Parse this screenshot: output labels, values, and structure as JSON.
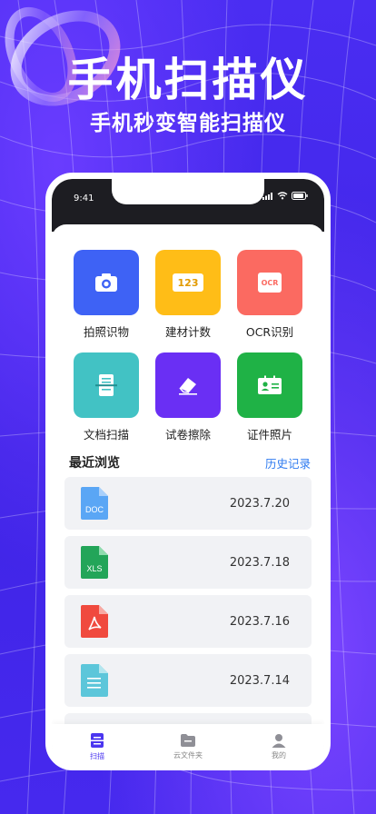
{
  "hero": {
    "title": "手机扫描仪",
    "subtitle": "手机秒变智能扫描仪"
  },
  "status": {
    "time": "9:41"
  },
  "tools": [
    {
      "label": "拍照识物",
      "icon": "camera-icon",
      "color": "#3e62f5"
    },
    {
      "label": "建材计数",
      "icon": "counter-123-icon",
      "color": "#ffbd17",
      "badge": "123"
    },
    {
      "label": "OCR识别",
      "icon": "ocr-icon",
      "color": "#fb6a61",
      "badge": "OCR"
    },
    {
      "label": "文档扫描",
      "icon": "document-scan-icon",
      "color": "#42c2c4"
    },
    {
      "label": "试卷擦除",
      "icon": "eraser-icon",
      "color": "#6a2ff4"
    },
    {
      "label": "证件照片",
      "icon": "id-card-icon",
      "color": "#1fb246"
    }
  ],
  "recent": {
    "title": "最近浏览",
    "history_link": "历史记录",
    "items": [
      {
        "type": "DOC",
        "icon": "doc-file-icon",
        "color": "#5aa6f5",
        "date": "2023.7.20"
      },
      {
        "type": "XLS",
        "icon": "xls-file-icon",
        "color": "#23a559",
        "date": "2023.7.18"
      },
      {
        "type": "PDF",
        "icon": "pdf-file-icon",
        "color": "#f04a3e",
        "date": "2023.7.16"
      },
      {
        "type": "TXT",
        "icon": "text-file-icon",
        "color": "#5cc6da",
        "date": "2023.7.14"
      }
    ]
  },
  "tabs": [
    {
      "label": "扫描",
      "icon": "scan-tab-icon",
      "active": true
    },
    {
      "label": "云文件夹",
      "icon": "folder-tab-icon",
      "active": false
    },
    {
      "label": "我的",
      "icon": "profile-tab-icon",
      "active": false
    }
  ],
  "colors": {
    "background": "#4b2bf0",
    "accent": "#4b36f0",
    "link": "#2f7bf0"
  }
}
